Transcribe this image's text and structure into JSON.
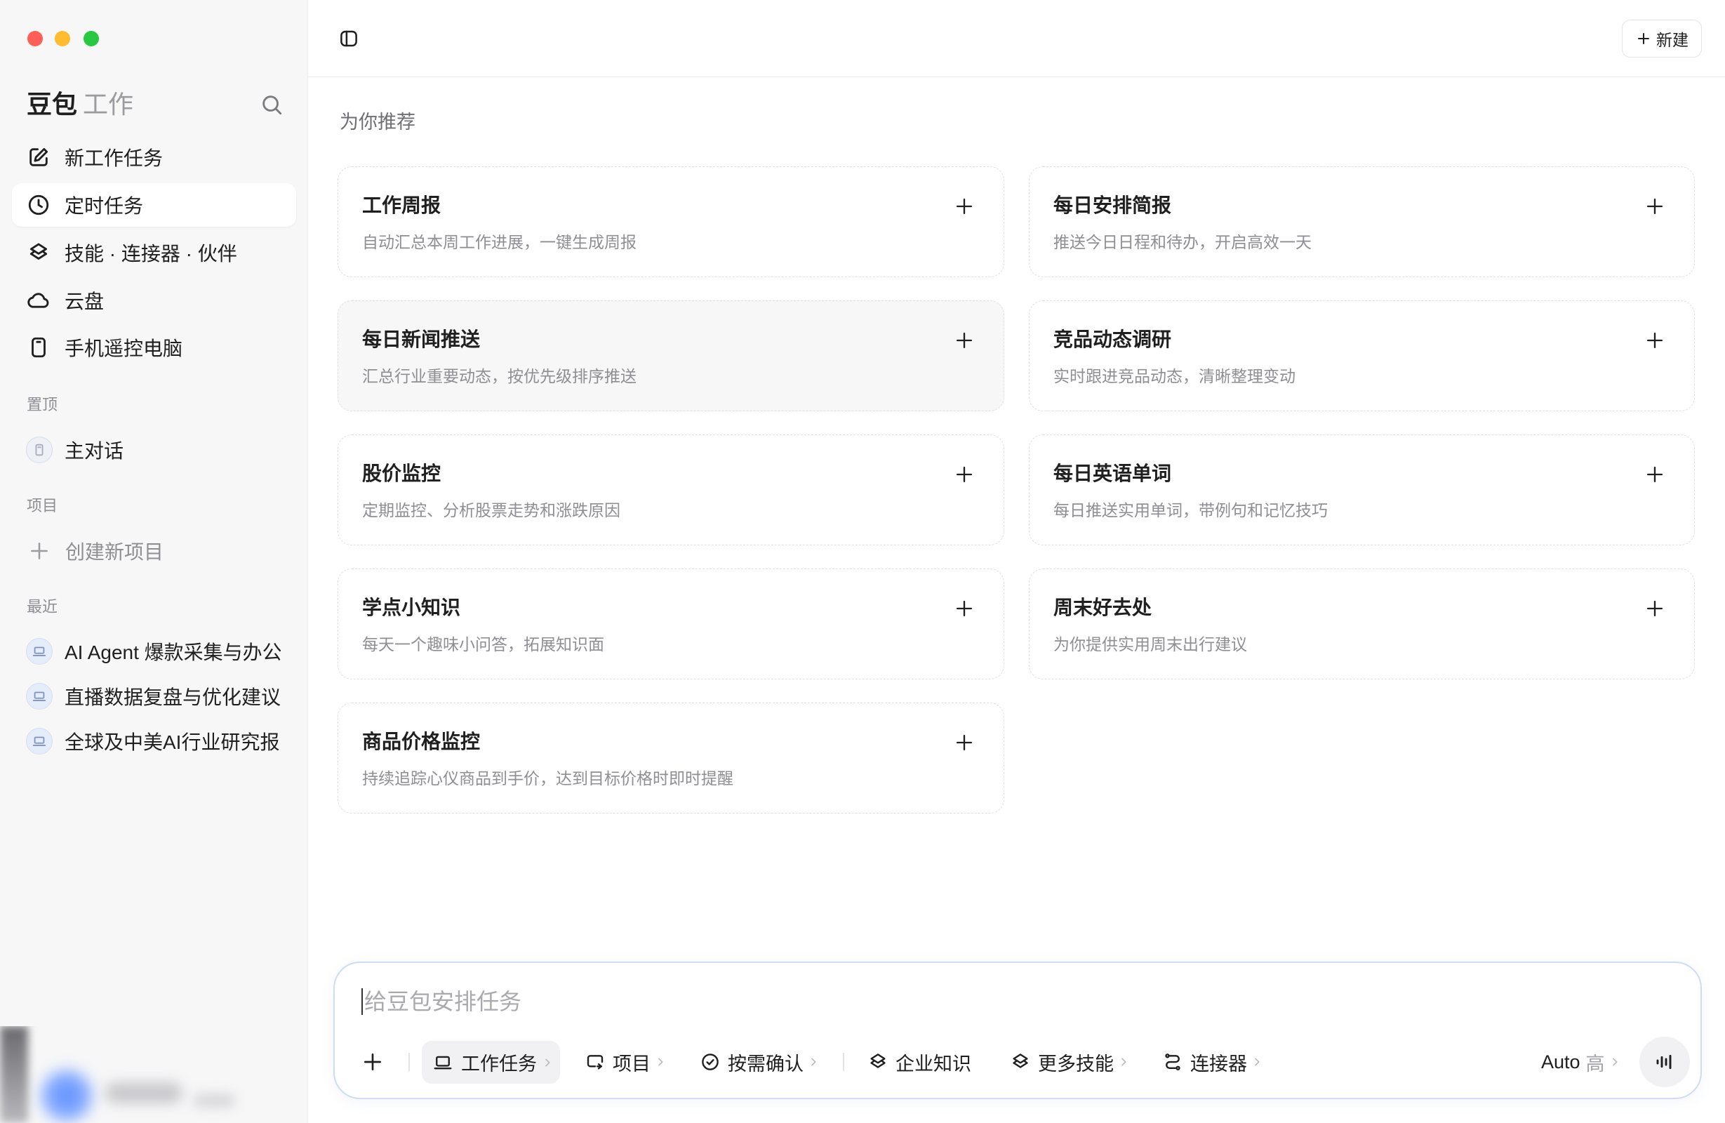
{
  "window": {
    "traffic_lights": {
      "close": "#ff5f57",
      "minimize": "#febc2e",
      "zoom": "#28c840"
    }
  },
  "sidebar": {
    "brand": "豆包",
    "brand_sub": "工作",
    "search_icon": "search-icon",
    "nav": [
      {
        "label": "新工作任务",
        "icon": "edit-icon"
      },
      {
        "label": "定时任务",
        "icon": "clock-icon",
        "selected": true
      },
      {
        "label": "技能 · 连接器 · 伙伴",
        "icon": "layers-icon"
      },
      {
        "label": "云盘",
        "icon": "cloud-icon"
      },
      {
        "label": "手机遥控电脑",
        "icon": "phone-icon"
      }
    ],
    "pinned": {
      "label": "置顶",
      "items": [
        {
          "label": "主对话",
          "icon": "document-icon"
        }
      ]
    },
    "projects": {
      "label": "项目",
      "create_label": "创建新项目"
    },
    "recent": {
      "label": "最近",
      "items": [
        {
          "label": "AI Agent 爆款采集与办公",
          "icon": "laptop-icon"
        },
        {
          "label": "直播数据复盘与优化建议",
          "icon": "laptop-icon"
        },
        {
          "label": "全球及中美AI行业研究报",
          "icon": "laptop-icon"
        }
      ]
    }
  },
  "header": {
    "toggle_icon": "sidebar-toggle-icon",
    "new_label": "新建"
  },
  "main": {
    "section_title": "为你推荐",
    "cards": [
      {
        "title": "工作周报",
        "desc": "自动汇总本周工作进展，一键生成周报"
      },
      {
        "title": "每日安排简报",
        "desc": "推送今日日程和待办，开启高效一天"
      },
      {
        "title": "每日新闻推送",
        "desc": "汇总行业重要动态，按优先级排序推送",
        "highlighted": true
      },
      {
        "title": "竞品动态调研",
        "desc": "实时跟进竞品动态，清晰整理变动"
      },
      {
        "title": "股价监控",
        "desc": "定期监控、分析股票走势和涨跌原因"
      },
      {
        "title": "每日英语单词",
        "desc": "每日推送实用单词，带例句和记忆技巧"
      },
      {
        "title": "学点小知识",
        "desc": "每天一个趣味小问答，拓展知识面"
      },
      {
        "title": "周末好去处",
        "desc": "为你提供实用周末出行建议"
      },
      {
        "title": "商品价格监控",
        "desc": "持续追踪心仪商品到手价，达到目标价格时即时提醒"
      }
    ]
  },
  "composer": {
    "placeholder": "给豆包安排任务",
    "tools": [
      {
        "label": "工作任务",
        "icon": "laptop-icon",
        "active": true
      },
      {
        "label": "项目",
        "icon": "project-icon"
      },
      {
        "label": "按需确认",
        "icon": "check-badge-icon"
      },
      {
        "label": "企业知识",
        "icon": "layers-icon"
      },
      {
        "label": "更多技能",
        "icon": "layers-icon"
      },
      {
        "label": "连接器",
        "icon": "connector-icon"
      }
    ],
    "model": "Auto",
    "effort": "高",
    "voice_icon": "voice-icon"
  },
  "colors": {
    "sidebar_bg": "#f7f7f8",
    "selected_bg": "#ffffff",
    "composer_border": "#cddcf7",
    "muted_text": "#8e8e93",
    "card_border": "#e0e0e4"
  }
}
